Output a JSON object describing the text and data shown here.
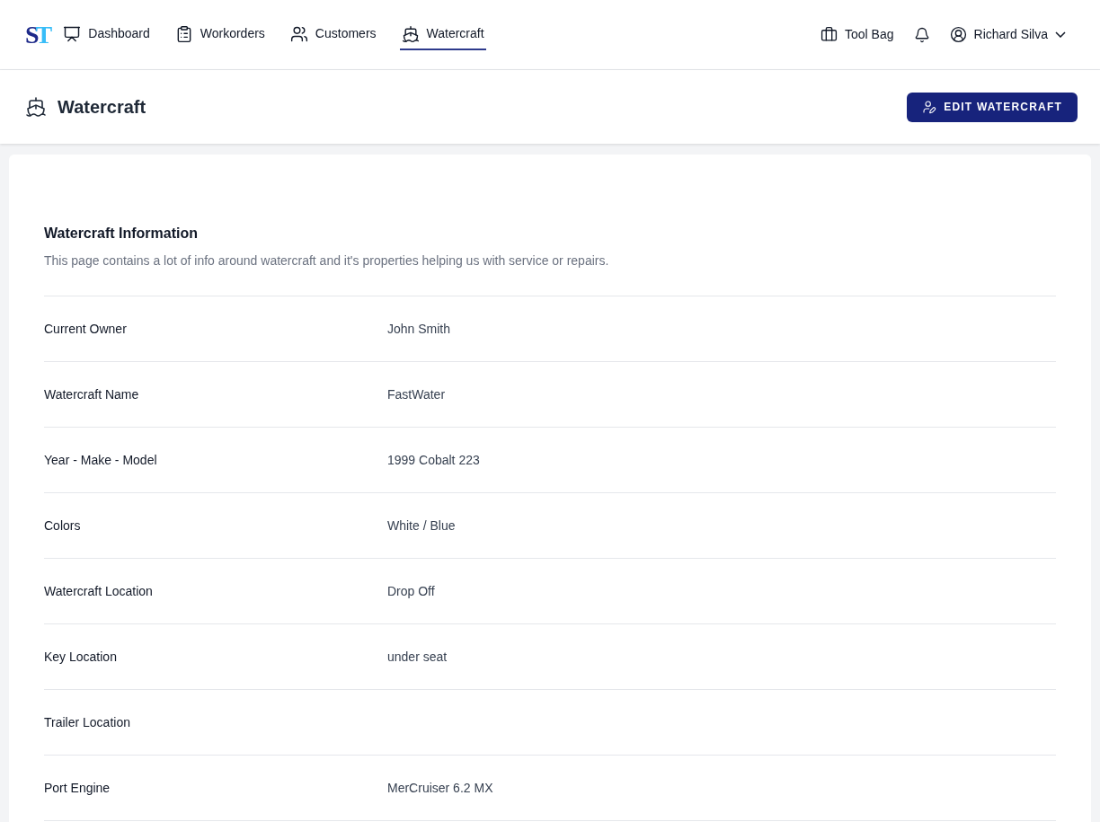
{
  "logo": {
    "text": "ST"
  },
  "nav": [
    {
      "label": "Dashboard",
      "selected": false
    },
    {
      "label": "Workorders",
      "selected": false
    },
    {
      "label": "Customers",
      "selected": false
    },
    {
      "label": "Watercraft",
      "selected": true
    }
  ],
  "toolbar": {
    "tool_bag": "Tool Bag",
    "user": "Richard Silva"
  },
  "page_header": {
    "title": "Watercraft",
    "action": "EDIT WATERCRAFT"
  },
  "section": {
    "title": "Watercraft Information",
    "description": "This page contains a lot of info around watercraft and it's properties helping us with service or repairs."
  },
  "fields": [
    {
      "label": "Current Owner",
      "value": "John Smith"
    },
    {
      "label": "Watercraft Name",
      "value": "FastWater"
    },
    {
      "label": "Year - Make - Model",
      "value": "1999 Cobalt 223"
    },
    {
      "label": "Colors",
      "value": "White / Blue"
    },
    {
      "label": "Watercraft Location",
      "value": "Drop Off"
    },
    {
      "label": "Key Location",
      "value": "under seat"
    },
    {
      "label": "Trailer Location"
    },
    {
      "label": "Port Engine",
      "value": "MerCruiser 6.2 MX"
    }
  ]
}
